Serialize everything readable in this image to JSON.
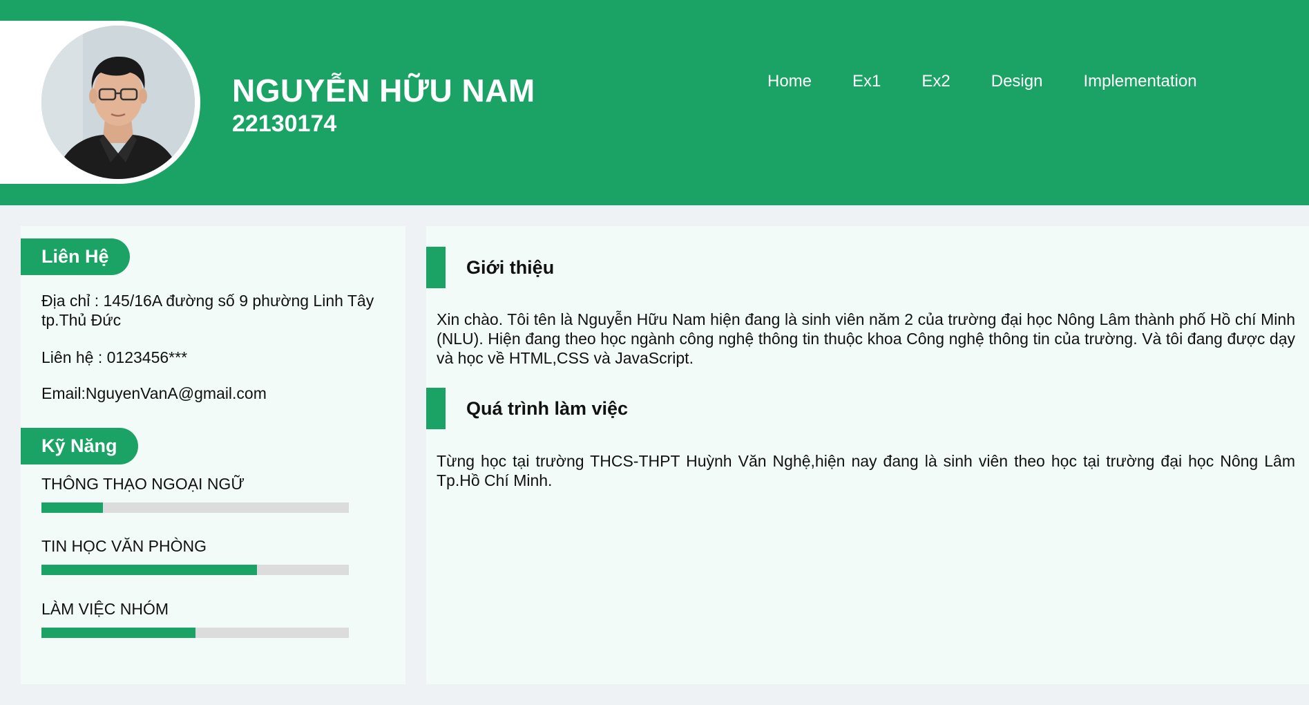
{
  "header": {
    "name": "NGUYỄN HỮU NAM",
    "student_id": "22130174",
    "nav": [
      "Home",
      "Ex1",
      "Ex2",
      "Design",
      "Implementation"
    ]
  },
  "sidebar": {
    "contact_title": "Liên Hệ",
    "address": "Địa chỉ : 145/16A đường số 9 phường Linh Tây tp.Thủ Đức",
    "phone": "Liên hệ : 0123456***",
    "email": "Email:NguyenVanA@gmail.com",
    "skills_title": "Kỹ Năng",
    "skills": [
      {
        "label": "THÔNG THẠO NGOẠI NGỮ",
        "level": 0.2
      },
      {
        "label": "TIN HỌC VĂN PHÒNG",
        "level": 0.7
      },
      {
        "label": "LÀM VIỆC NHÓM",
        "level": 0.5
      }
    ]
  },
  "main": {
    "intro_title": "Giới thiệu",
    "intro_text": "Xin chào. Tôi tên là Nguyễn Hữu Nam hiện đang là sinh viên năm 2 của trường đại học Nông Lâm thành phố Hồ chí Minh (NLU). Hiện đang theo học ngành công nghệ thông tin thuộc khoa Công nghệ thông tin của trường. Và tôi đang được dạy và học về HTML,CSS và JavaScript.",
    "work_title": "Quá trình làm việc",
    "work_text": "Từng học tại trường THCS-THPT Huỳnh Văn Nghệ,hiện nay đang là sinh viên theo học tại trường đại học Nông Lâm Tp.Hồ Chí Minh."
  },
  "colors": {
    "accent": "#1ba366",
    "panel": "#f2fbf8",
    "page": "#eff2f5",
    "bar_track": "#dcdcdc"
  }
}
